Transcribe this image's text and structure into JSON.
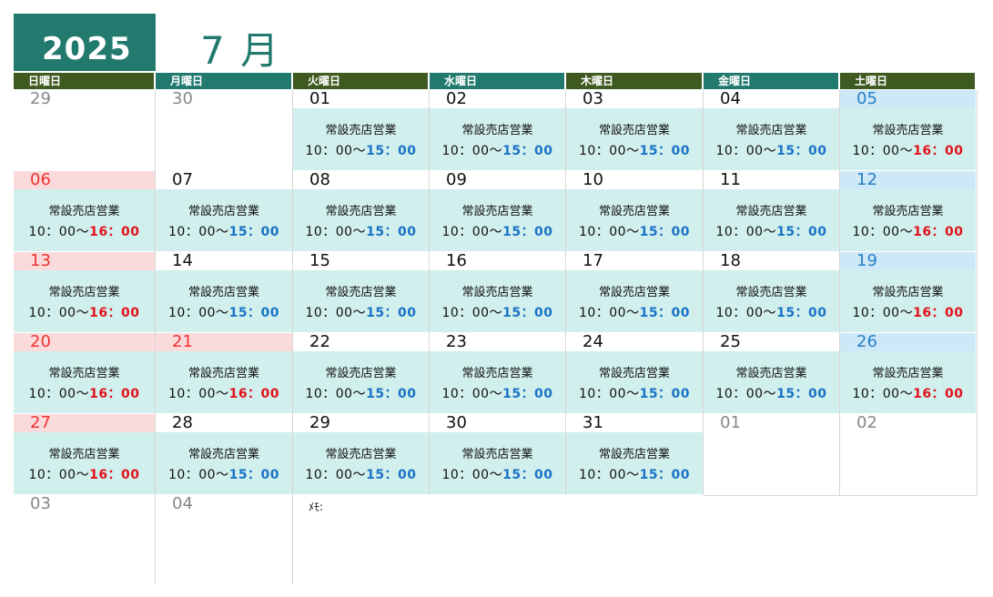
{
  "header": {
    "year": "2025",
    "month": "7 月"
  },
  "weekdays": [
    "日曜日",
    "月曜日",
    "火曜日",
    "水曜日",
    "木曜日",
    "金曜日",
    "土曜日"
  ],
  "event_label": "常設売店営業",
  "time_prefix": "10：00〜",
  "time_weekday": "15：00",
  "time_weekend": "16：00",
  "memo_label": "ﾒﾓ:",
  "colors": {
    "teal": "#227a6f",
    "dark_green": "#3f5a20",
    "info_bg": "#d1efec",
    "holiday_bg": "#fadadb",
    "saturday_bg": "#cde8f7",
    "blue_time": "#1b73c7",
    "red_time": "#e0131c"
  },
  "weeks": [
    [
      {
        "day": "29",
        "type": "out"
      },
      {
        "day": "30",
        "type": "out"
      },
      {
        "day": "01",
        "type": "cur",
        "open": "weekday"
      },
      {
        "day": "02",
        "type": "cur",
        "open": "weekday"
      },
      {
        "day": "03",
        "type": "cur",
        "open": "weekday"
      },
      {
        "day": "04",
        "type": "cur",
        "open": "weekday"
      },
      {
        "day": "05",
        "type": "sat",
        "open": "weekend"
      }
    ],
    [
      {
        "day": "06",
        "type": "sun",
        "open": "weekend"
      },
      {
        "day": "07",
        "type": "cur",
        "open": "weekday"
      },
      {
        "day": "08",
        "type": "cur",
        "open": "weekday"
      },
      {
        "day": "09",
        "type": "cur",
        "open": "weekday"
      },
      {
        "day": "10",
        "type": "cur",
        "open": "weekday"
      },
      {
        "day": "11",
        "type": "cur",
        "open": "weekday"
      },
      {
        "day": "12",
        "type": "sat",
        "open": "weekend"
      }
    ],
    [
      {
        "day": "13",
        "type": "sun",
        "open": "weekend"
      },
      {
        "day": "14",
        "type": "cur",
        "open": "weekday"
      },
      {
        "day": "15",
        "type": "cur",
        "open": "weekday"
      },
      {
        "day": "16",
        "type": "cur",
        "open": "weekday"
      },
      {
        "day": "17",
        "type": "cur",
        "open": "weekday"
      },
      {
        "day": "18",
        "type": "cur",
        "open": "weekday"
      },
      {
        "day": "19",
        "type": "sat",
        "open": "weekend"
      }
    ],
    [
      {
        "day": "20",
        "type": "sun",
        "open": "weekend"
      },
      {
        "day": "21",
        "type": "sun",
        "open": "weekend"
      },
      {
        "day": "22",
        "type": "cur",
        "open": "weekday"
      },
      {
        "day": "23",
        "type": "cur",
        "open": "weekday"
      },
      {
        "day": "24",
        "type": "cur",
        "open": "weekday"
      },
      {
        "day": "25",
        "type": "cur",
        "open": "weekday"
      },
      {
        "day": "26",
        "type": "sat",
        "open": "weekend"
      }
    ],
    [
      {
        "day": "27",
        "type": "sun",
        "open": "weekend"
      },
      {
        "day": "28",
        "type": "cur",
        "open": "weekday"
      },
      {
        "day": "29",
        "type": "cur",
        "open": "weekday"
      },
      {
        "day": "30",
        "type": "cur",
        "open": "weekday"
      },
      {
        "day": "31",
        "type": "cur",
        "open": "weekday"
      },
      {
        "day": "01",
        "type": "out"
      },
      {
        "day": "02",
        "type": "out"
      }
    ],
    [
      {
        "day": "03",
        "type": "out"
      },
      {
        "day": "04",
        "type": "out"
      }
    ]
  ]
}
